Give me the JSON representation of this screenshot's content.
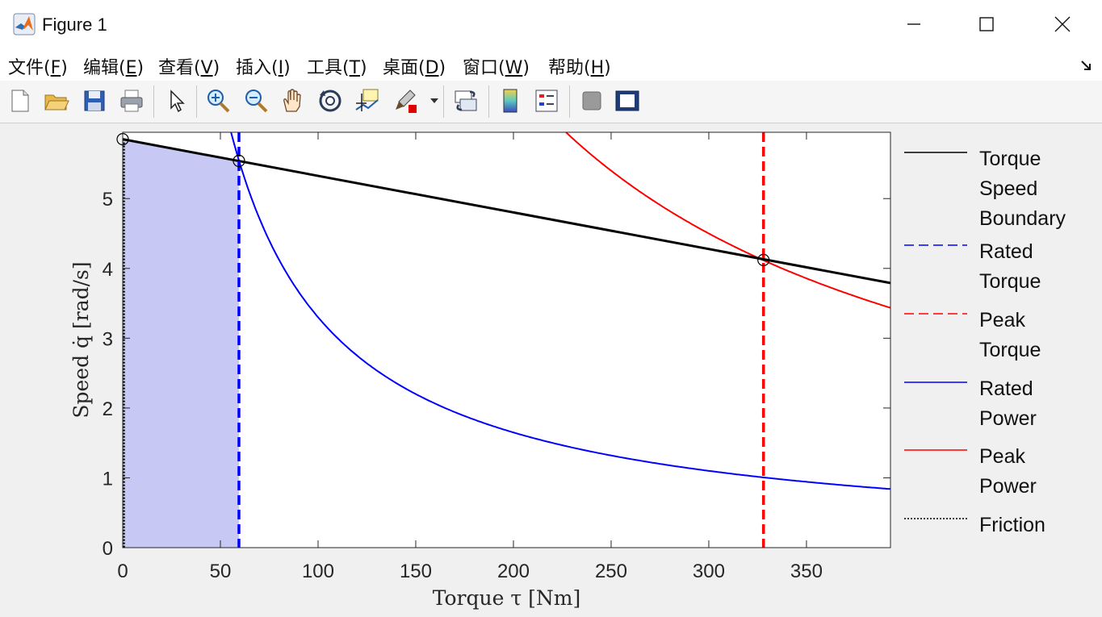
{
  "window": {
    "title": "Figure 1",
    "controls": [
      "minimize",
      "maximize",
      "close"
    ]
  },
  "menu": [
    {
      "label": "文件(",
      "mnemonic": "F",
      "suffix": ")"
    },
    {
      "label": "编辑(",
      "mnemonic": "E",
      "suffix": ")"
    },
    {
      "label": "查看(",
      "mnemonic": "V",
      "suffix": ")"
    },
    {
      "label": "插入(",
      "mnemonic": "I",
      "suffix": ")"
    },
    {
      "label": "工具(",
      "mnemonic": "T",
      "suffix": ")"
    },
    {
      "label": "桌面(",
      "mnemonic": "D",
      "suffix": ")"
    },
    {
      "label": "窗口(",
      "mnemonic": "W",
      "suffix": ")"
    },
    {
      "label": "帮助(",
      "mnemonic": "H",
      "suffix": ")"
    }
  ],
  "toolbar": {
    "icons": [
      "new-figure-icon",
      "open-file-icon",
      "save-icon",
      "print-icon",
      "pointer-icon",
      "zoom-in-icon",
      "zoom-out-icon",
      "pan-hand-icon",
      "rotate-3d-icon",
      "data-cursor-icon",
      "brush-icon",
      "link-plot-icon",
      "colorbar-icon",
      "legend-icon",
      "hide-plot-tools-icon",
      "show-plot-tools-icon"
    ]
  },
  "chart_data": {
    "type": "line",
    "xlabel": "Torque τ [Nm]",
    "ylabel": "Speed q̇ [rad/s]",
    "xlim": [
      0,
      393
    ],
    "ylim": [
      0,
      5.95
    ],
    "xticks": [
      0,
      50,
      100,
      150,
      200,
      250,
      300,
      350
    ],
    "yticks": [
      0,
      1,
      2,
      3,
      4,
      5
    ],
    "grid": false,
    "legend_position": "outside-right",
    "series": [
      {
        "name": "Torque Speed Boundary",
        "style": "solid",
        "color": "#000000",
        "points": [
          [
            0,
            5.85
          ],
          [
            393,
            3.79
          ]
        ]
      },
      {
        "name": "Rated Torque",
        "style": "dashed",
        "color": "#0000ff",
        "x": 59.5
      },
      {
        "name": "Peak Torque",
        "style": "dashed",
        "color": "#ff0000",
        "x": 328
      },
      {
        "name": "Rated Power",
        "style": "solid",
        "color": "#0000ff",
        "constant_product": 330
      },
      {
        "name": "Peak Power",
        "style": "solid",
        "color": "#ff0000",
        "constant_product": 1350
      },
      {
        "name": "Friction",
        "style": "dotted",
        "color": "#000000",
        "x": 0
      }
    ],
    "markers": [
      [
        0,
        5.85
      ],
      [
        59.5,
        5.54
      ],
      [
        328,
        4.12
      ]
    ],
    "shaded_region": {
      "x_from": 0,
      "x_to": 59.5,
      "color": "#c8c8f4"
    }
  },
  "legend": {
    "entries": [
      {
        "lines": [
          "Torque",
          "Speed",
          "Boundary"
        ]
      },
      {
        "lines": [
          "Rated",
          "Torque"
        ]
      },
      {
        "lines": [
          "Peak",
          "Torque"
        ]
      },
      {
        "lines": [
          "Rated",
          "Power"
        ]
      },
      {
        "lines": [
          "Peak",
          "Power"
        ]
      },
      {
        "lines": [
          "Friction"
        ]
      }
    ]
  }
}
